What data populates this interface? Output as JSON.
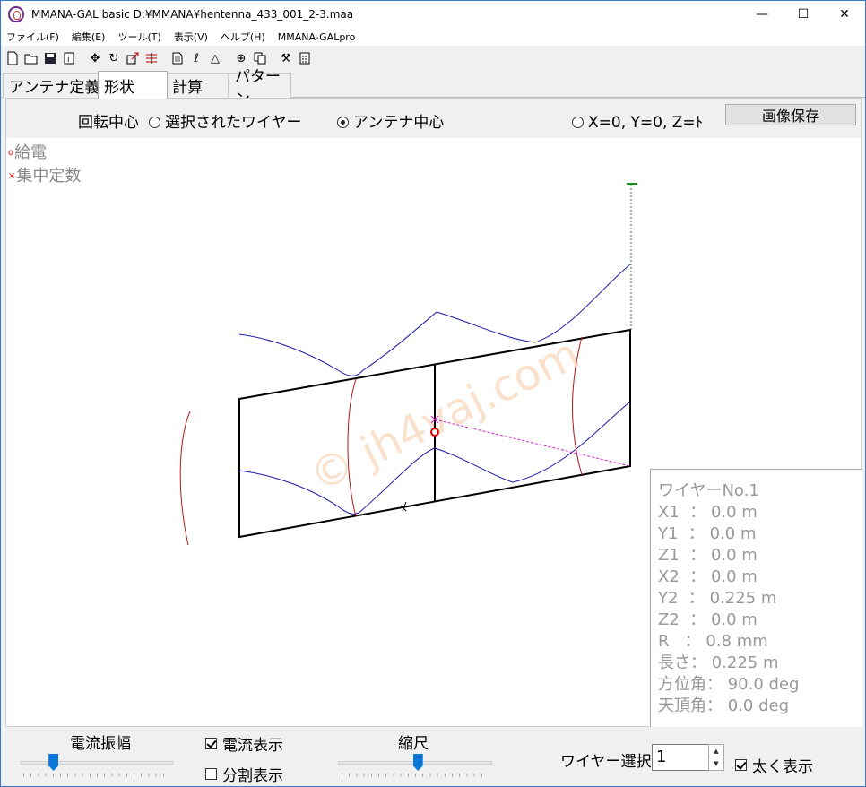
{
  "window": {
    "title": "MMANA-GAL basic D:¥MMANA¥hentenna_433_001_2-3.maa"
  },
  "window_controls": {
    "minimize": "—",
    "maximize": "☐",
    "close": "✕"
  },
  "menu": [
    "ファイル(F)",
    "編集(E)",
    "ツール(T)",
    "表示(V)",
    "ヘルプ(H)",
    "MMANA-GALpro"
  ],
  "toolbar_icons": [
    "new-file-icon",
    "open-folder-icon",
    "save-icon",
    "info-icon",
    "move-icon",
    "rotate-icon",
    "zoom-icon",
    "segment-icon",
    "document-icon",
    "text-icon",
    "triangle-icon",
    "target-icon",
    "copy-icon",
    "tools-icon",
    "calculator-icon"
  ],
  "tabs": [
    "アンテナ定義",
    "形状",
    "計算",
    "パターン"
  ],
  "active_tab": "形状",
  "rotation": {
    "label": "回転中心",
    "option_selected_wire": "選択されたワイヤー",
    "option_antenna_center": "アンテナ中心",
    "option_origin": "X=0, Y=0, Z=ﾄ",
    "selected": "antenna_center"
  },
  "save_image_label": "画像保存",
  "legend": {
    "feed": "給電",
    "load": "集中定数"
  },
  "watermark": "© jh4vaj.com",
  "wire_info": {
    "title": "ワイヤーNo.1",
    "rows": [
      "X1  ： 0.0 m",
      "Y1  ： 0.0 m",
      "Z1  ： 0.0 m",
      "X2  ： 0.0 m",
      "Y2  ： 0.225 m",
      "Z2  ： 0.0 m",
      "R   ： 0.8 mm",
      "長さ： 0.225 m",
      "方位角： 90.0 deg",
      "天頂角： 0.0 deg"
    ]
  },
  "bottom": {
    "current_amplitude_label": "電流振幅",
    "current_amplitude_value": 0.2,
    "show_current_label": "電流表示",
    "show_current_checked": true,
    "show_segments_label": "分割表示",
    "show_segments_checked": false,
    "scale_label": "縮尺",
    "scale_value": 0.52,
    "wire_select_label": "ワイヤー選択",
    "wire_select_value": "1",
    "bold_label": "太く表示",
    "bold_checked": true
  },
  "colors": {
    "structure": "#000000",
    "current": "#1a1aa8",
    "pattern_red": "#b01818",
    "feed": "#e00000",
    "axis_green": "#1a8a1a",
    "axis_magenta": "#d020d0"
  }
}
